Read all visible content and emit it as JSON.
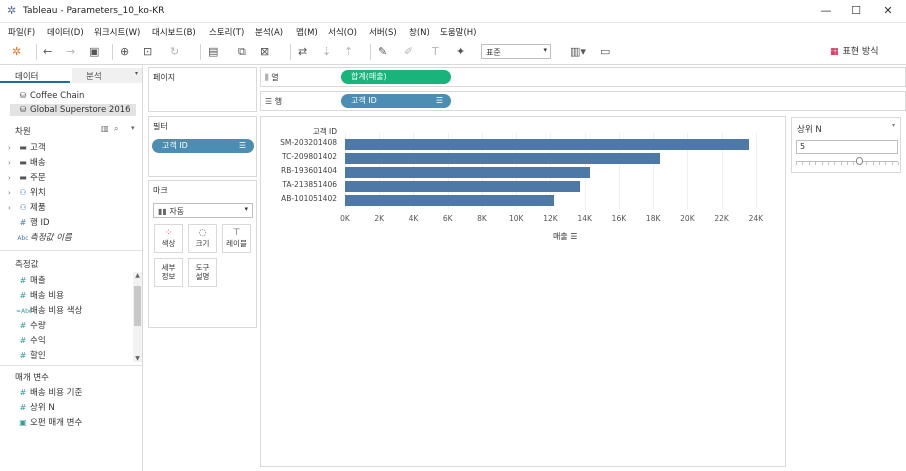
{
  "window": {
    "title": "Tableau - Parameters_10_ko-KR",
    "minimize": "—",
    "maximize": "☐",
    "close": "✕"
  },
  "menu": [
    "파일(F)",
    "데이터(D)",
    "워크시트(W)",
    "대시보드(B)",
    "스토리(T)",
    "분석(A)",
    "맵(M)",
    "서식(O)",
    "서버(S)",
    "창(N)",
    "도움말(H)"
  ],
  "toolbar": {
    "format_dropdown": "표준",
    "show_me": "표현 방식"
  },
  "datapane": {
    "tab_data": "데이터",
    "tab_analysis": "분석",
    "sources": [
      "Coffee Chain",
      "Global Superstore 2016"
    ],
    "dimensions_header": "차원",
    "dimensions": [
      {
        "label": "고객",
        "icon": "folder"
      },
      {
        "label": "배송",
        "icon": "folder"
      },
      {
        "label": "주문",
        "icon": "folder"
      },
      {
        "label": "위치",
        "icon": "hierarchy"
      },
      {
        "label": "제품",
        "icon": "hierarchy"
      },
      {
        "label": "행 ID",
        "icon": "#"
      },
      {
        "label": "측정값 이름",
        "icon": "Abc"
      }
    ],
    "measures_header": "측정값",
    "measures": [
      {
        "label": "매출",
        "icon": "#"
      },
      {
        "label": "배송 비용",
        "icon": "#"
      },
      {
        "label": "배송 비용 색상",
        "icon": "Abc"
      },
      {
        "label": "수량",
        "icon": "#"
      },
      {
        "label": "수익",
        "icon": "#"
      },
      {
        "label": "할인",
        "icon": "#"
      }
    ],
    "params_header": "매개 변수",
    "params": [
      {
        "label": "배송 비용 기준",
        "icon": "#"
      },
      {
        "label": "상위 N",
        "icon": "#"
      },
      {
        "label": "오펀 매개 변수",
        "icon": "cal"
      }
    ]
  },
  "shelves": {
    "pages": "페이지",
    "filters": "필터",
    "filter_pill": "고객 ID",
    "marks": "마크",
    "marks_type": "자동",
    "mark_buttons": [
      {
        "label": "색상",
        "icon": "color"
      },
      {
        "label": "크기",
        "icon": "size"
      },
      {
        "label": "레이블",
        "icon": "label"
      },
      {
        "label": "세부\n정보",
        "icon": "detail"
      },
      {
        "label": "도구\n설명",
        "icon": "tooltip"
      }
    ],
    "columns_label": "열",
    "columns_pill": "합계(매출)",
    "rows_label": "행",
    "rows_pill": "고객 ID"
  },
  "chart_data": {
    "type": "bar",
    "orientation": "horizontal",
    "row_header": "고객 ID",
    "xlabel": "매출",
    "categories": [
      "SM-203201408",
      "TC-209801402",
      "RB-193601404",
      "TA-213851406",
      "AB-101051402"
    ],
    "values": [
      23600,
      18400,
      14300,
      13700,
      12200
    ],
    "xlim": [
      0,
      25000
    ],
    "xticks": [
      "0K",
      "2K",
      "4K",
      "6K",
      "8K",
      "10K",
      "12K",
      "14K",
      "16K",
      "18K",
      "20K",
      "22K",
      "24K"
    ],
    "bar_color": "#4e79a7"
  },
  "parameter_card": {
    "title": "상위 N",
    "value": "5",
    "slider_fraction": 0.62
  }
}
